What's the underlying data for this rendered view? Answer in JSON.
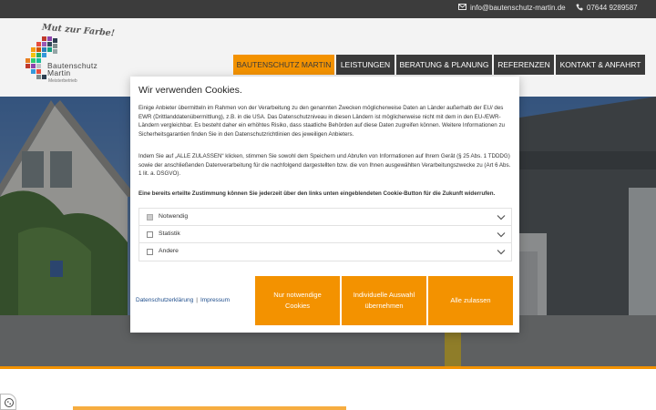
{
  "topbar": {
    "email": "info@bautenschutz-martin.de",
    "phone": "07644 9289587",
    "icons": {
      "email": "envelope-icon",
      "phone": "phone-icon"
    }
  },
  "logo": {
    "tagline": "Mut zur Farbe!",
    "name_line1": "Bautenschutz",
    "name_line2": "Martin",
    "subtitle": "Meisterbetrieb"
  },
  "nav": {
    "items": [
      {
        "label": "BAUTENSCHUTZ MARTIN",
        "active": true
      },
      {
        "label": "LEISTUNGEN",
        "active": false
      },
      {
        "label": "BERATUNG & PLANUNG",
        "active": false
      },
      {
        "label": "REFERENZEN",
        "active": false
      },
      {
        "label": "KONTAKT & ANFAHRT",
        "active": false
      }
    ]
  },
  "cookie_dialog": {
    "title": "Wir verwenden Cookies.",
    "paragraph1": "Einige Anbieter übermitteln im Rahmen von der Verarbeitung zu den genannten Zwecken möglicherweise Daten an Länder außerhalb der EU/ des EWR (Drittlanddatenübermittlung), z.B. in die USA. Das Datenschutzniveau in diesen Ländern ist möglicherweise nicht mit dem in den EU-/EWR-Ländern vergleichbar. Es besteht daher ein erhöhtes Risiko, dass staatliche Behörden auf diese Daten zugreifen können. Weitere Informationen zu Sicherheitsgarantien finden Sie in den Datenschutzrichtlinien des jeweiligen Anbieters.",
    "paragraph2": "Indem Sie auf „ALLE ZULASSEN“ klicken, stimmen Sie sowohl dem Speichern und Abrufen von Informationen auf Ihrem Gerät (§ 25 Abs. 1 TDDDG) sowie der anschließenden Datenverarbeitung für die nachfolgend dargestellten bzw. die von Ihnen ausgewählten Verarbeitungszwecke zu (Art 6 Abs. 1 lit. a. DSGVO).",
    "paragraph3": "Eine bereits erteilte Zustimmung können Sie jederzeit über den links unten eingeblendeten Cookie-Button für die Zukunft widerrufen.",
    "categories": [
      {
        "label": "Notwendig",
        "checked": true,
        "disabled": true
      },
      {
        "label": "Statistik",
        "checked": false,
        "disabled": false
      },
      {
        "label": "Andere",
        "checked": false,
        "disabled": false
      }
    ],
    "links": {
      "privacy": "Datenschutzerklärung",
      "separator": "|",
      "imprint": "Impressum"
    },
    "buttons": {
      "necessary": "Nur notwendige Cookies",
      "individual": "Individuelle Auswahl übernehmen",
      "accept_all": "Alle zulassen"
    }
  },
  "colors": {
    "accent": "#f39200",
    "nav_bg": "#3a3a3a",
    "topbar_bg": "#3c3c3c",
    "header_bg": "#f3f3f3",
    "link": "#1f4e8c"
  }
}
